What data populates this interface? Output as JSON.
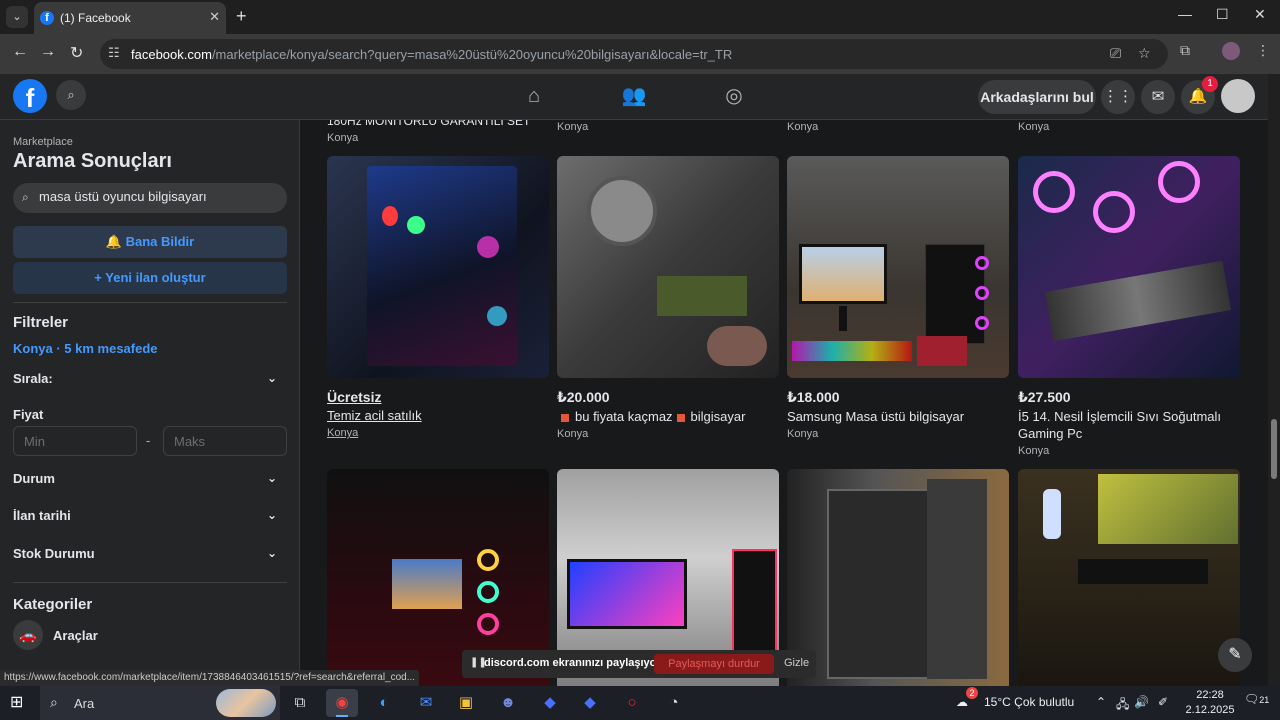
{
  "browser": {
    "tab_title": "(1) Facebook",
    "url_domain": "facebook.com",
    "url_path": "/marketplace/konya/search?query=masa%20üstü%20oyuncu%20bilgisayarı&locale=tr_TR"
  },
  "fb_nav": {
    "find_friends": "Arkadaşlarını bul",
    "notification_count": "1"
  },
  "sidebar": {
    "breadcrumb": "Marketplace",
    "title": "Arama Sonuçları",
    "search_value": "masa üstü oyuncu bilgisayarı",
    "notify_button": "Bana Bildir",
    "create_listing_button": "Yeni ilan oluştur",
    "filters_heading": "Filtreler",
    "location_filter": "Konya · 5 km mesafede",
    "sort_label": "Sırala:",
    "price_heading": "Fiyat",
    "price_min_placeholder": "Min",
    "price_max_placeholder": "Maks",
    "price_separator": "-",
    "condition_label": "Durum",
    "listing_date_label": "İlan tarihi",
    "stock_label": "Stok Durumu",
    "categories_heading": "Kategoriler",
    "category_vehicles": "Araçlar"
  },
  "main": {
    "prev_row_title": "180Hz MONİTÖRLÜ GARANTİLİ SET",
    "prev_row_location": "Konya",
    "listings": [
      {
        "price": "Ücretsiz",
        "title": "Temiz acil satılık",
        "location": "Konya"
      },
      {
        "price": "₺20.000",
        "title_a": "bu fiyata kaçmaz",
        "title_b": "bilgisayar",
        "location": "Konya"
      },
      {
        "price": "₺18.000",
        "title": "Samsung Masa üstü bilgisayar",
        "location": "Konya"
      },
      {
        "price": "₺27.500",
        "title": "İ5 14. Nesil İşlemcili Sıvı Soğutmalı Gaming Pc",
        "location": "Konya"
      }
    ]
  },
  "share_bar": {
    "text": "discord.com ekranınızı paylaşıyor.",
    "stop_button": "Paylaşmayı durdur",
    "hide_button": "Gizle"
  },
  "status_url": "https://www.facebook.com/marketplace/item/1738846403461515/?ref=search&referral_cod...",
  "taskbar": {
    "search_label": "Ara",
    "weather_badge": "2",
    "weather": "15°C  Çok bulutlu",
    "time": "22:28",
    "date": "2.12.2025",
    "notif_count": "21"
  }
}
